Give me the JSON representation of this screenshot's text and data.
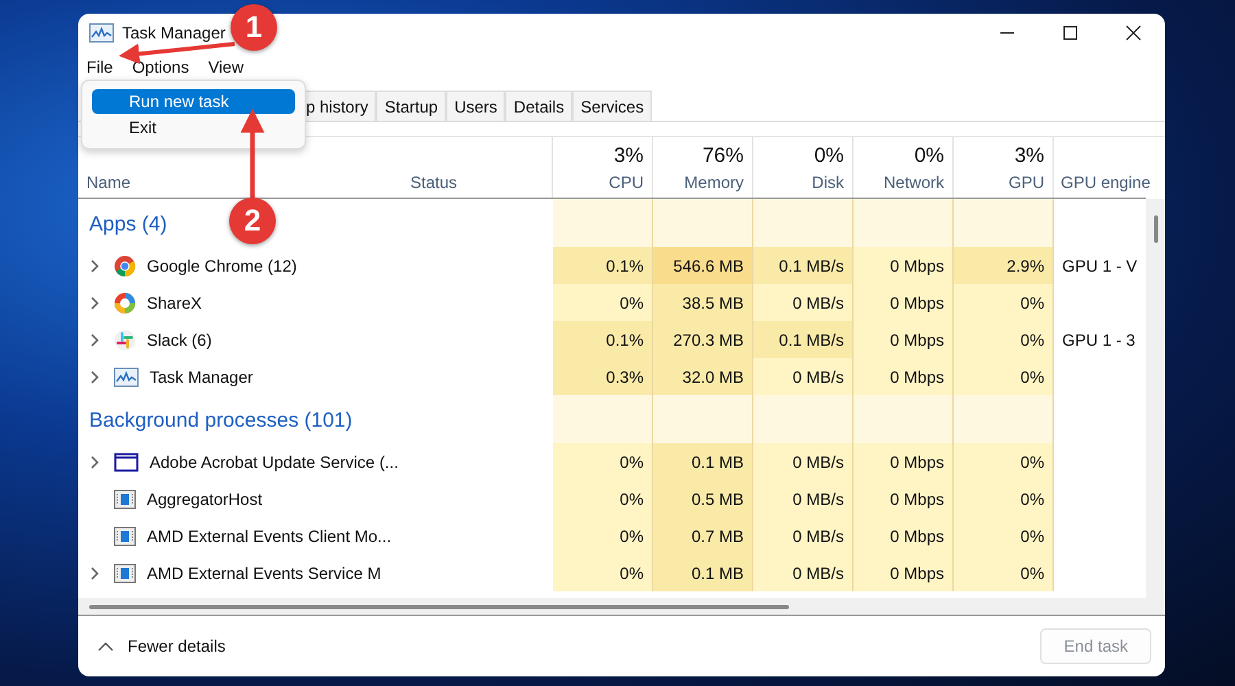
{
  "window": {
    "title": "Task Manager"
  },
  "menu": [
    {
      "label": "File"
    },
    {
      "label": "Options"
    },
    {
      "label": "View"
    }
  ],
  "file_menu": [
    {
      "label": "Run new task",
      "selected": true
    },
    {
      "label": "Exit",
      "selected": false
    }
  ],
  "tabs": [
    {
      "label": "p history",
      "selected": false
    },
    {
      "label": "Startup",
      "selected": false
    },
    {
      "label": "Users",
      "selected": false
    },
    {
      "label": "Details",
      "selected": false
    },
    {
      "label": "Services",
      "selected": false
    }
  ],
  "columns": [
    {
      "name": "Name"
    },
    {
      "name": "Status"
    },
    {
      "percent": "3%",
      "name": "CPU"
    },
    {
      "percent": "76%",
      "name": "Memory"
    },
    {
      "percent": "0%",
      "name": "Disk"
    },
    {
      "percent": "0%",
      "name": "Network"
    },
    {
      "percent": "3%",
      "name": "GPU"
    },
    {
      "name": "GPU engine"
    }
  ],
  "groups": [
    {
      "title": "Apps (4)",
      "rows": [
        {
          "name": "Google Chrome (12)",
          "kind": "browser",
          "expandable": true,
          "cells": [
            {
              "value": "0.1%",
              "color": "#f9eaa8"
            },
            {
              "value": "546.6 MB",
              "color": "#f9dc8c"
            },
            {
              "value": "0.1 MB/s",
              "color": "#f9eaa8"
            },
            {
              "value": "0 Mbps",
              "color": "#fff4c4"
            },
            {
              "value": "2.9%",
              "color": "#f9eaa8"
            }
          ],
          "engine": "GPU 1 - V"
        },
        {
          "name": "ShareX",
          "kind": "swirl",
          "expandable": true,
          "cells": [
            {
              "value": "0%",
              "color": "#fff4c4"
            },
            {
              "value": "38.5 MB",
              "color": "#f9eaa8"
            },
            {
              "value": "0 MB/s",
              "color": "#fff4c4"
            },
            {
              "value": "0 Mbps",
              "color": "#fff4c4"
            },
            {
              "value": "0%",
              "color": "#fff4c4"
            }
          ]
        },
        {
          "name": "Slack (6)",
          "kind": "hash",
          "expandable": true,
          "cells": [
            {
              "value": "0.1%",
              "color": "#f9eaa8"
            },
            {
              "value": "270.3 MB",
              "color": "#f9eaa8"
            },
            {
              "value": "0.1 MB/s",
              "color": "#f9eaa8"
            },
            {
              "value": "0 Mbps",
              "color": "#fff4c4"
            },
            {
              "value": "0%",
              "color": "#fff4c4"
            }
          ],
          "engine": "GPU 1 - 3"
        },
        {
          "name": "Task Manager",
          "kind": "chart",
          "expandable": true,
          "cells": [
            {
              "value": "0.3%",
              "color": "#f9eaa8"
            },
            {
              "value": "32.0 MB",
              "color": "#f9eaa8"
            },
            {
              "value": "0 MB/s",
              "color": "#fff4c4"
            },
            {
              "value": "0 Mbps",
              "color": "#fff4c4"
            },
            {
              "value": "0%",
              "color": "#fff4c4"
            }
          ]
        }
      ]
    },
    {
      "title": "Background processes (101)",
      "rows": [
        {
          "name": "Adobe Acrobat Update Service (...",
          "kind": "window",
          "expandable": true,
          "cells": [
            {
              "value": "0%",
              "color": "#fff4c4"
            },
            {
              "value": "0.1 MB",
              "color": "#f9eaa8"
            },
            {
              "value": "0 MB/s",
              "color": "#fff4c4"
            },
            {
              "value": "0 Mbps",
              "color": "#fff4c4"
            },
            {
              "value": "0%",
              "color": "#fff4c4"
            }
          ]
        },
        {
          "name": "AggregatorHost",
          "kind": "service",
          "expandable": false,
          "cells": [
            {
              "value": "0%",
              "color": "#fff4c4"
            },
            {
              "value": "0.5 MB",
              "color": "#f9eaa8"
            },
            {
              "value": "0 MB/s",
              "color": "#fff4c4"
            },
            {
              "value": "0 Mbps",
              "color": "#fff4c4"
            },
            {
              "value": "0%",
              "color": "#fff4c4"
            }
          ]
        },
        {
          "name": "AMD External Events Client Mo...",
          "kind": "service",
          "expandable": false,
          "cells": [
            {
              "value": "0%",
              "color": "#fff4c4"
            },
            {
              "value": "0.7 MB",
              "color": "#f9eaa8"
            },
            {
              "value": "0 MB/s",
              "color": "#fff4c4"
            },
            {
              "value": "0 Mbps",
              "color": "#fff4c4"
            },
            {
              "value": "0%",
              "color": "#fff4c4"
            }
          ]
        },
        {
          "name": "AMD External Events Service M",
          "kind": "service",
          "expandable": true,
          "cells": [
            {
              "value": "0%",
              "color": "#fff4c4"
            },
            {
              "value": "0.1 MB",
              "color": "#f9eaa8"
            },
            {
              "value": "0 MB/s",
              "color": "#fff4c4"
            },
            {
              "value": "0 Mbps",
              "color": "#fff4c4"
            },
            {
              "value": "0%",
              "color": "#fff4c4"
            }
          ]
        }
      ]
    }
  ],
  "footer": {
    "toggle": "Fewer details",
    "end_task": {
      "label": "End task",
      "disabled": true
    }
  },
  "annotations": [
    {
      "label": "1"
    },
    {
      "label": "2"
    }
  ]
}
